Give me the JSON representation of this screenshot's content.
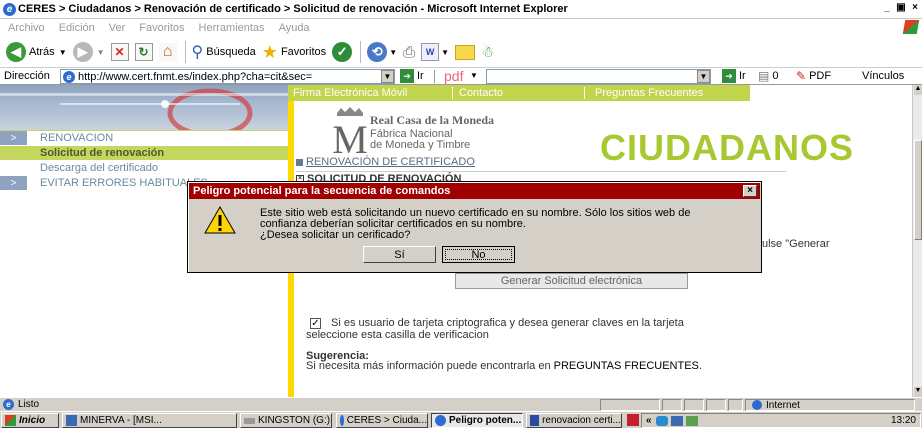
{
  "window": {
    "title": "CERES > Ciudadanos > Renovación de certificado > Solicitud de renovación - Microsoft Internet Explorer",
    "controls": [
      "_",
      "и",
      "×"
    ]
  },
  "menu": [
    "Archivo",
    "Edición",
    "Ver",
    "Favoritos",
    "Herramientas",
    "Ayuda"
  ],
  "toolbar": {
    "back": "Atrás",
    "search": "Búsqueda",
    "favorites": "Favoritos"
  },
  "address": {
    "label": "Dirección",
    "url": "http://www.cert.fnmt.es/index.php?cha=cit&sec=",
    "go": "Ir",
    "pdf_label": "pdf",
    "go2": "Ir",
    "counter": "0",
    "pdf": "PDF",
    "links": "Vínculos"
  },
  "site": {
    "topnav": [
      "Firma Electrónica Móvil",
      "Contacto",
      "Preguntas Frecuentes"
    ],
    "logo": {
      "line1": "Real Casa de la Moneda",
      "line2": "Fábrica Nacional",
      "line3": "de Moneda y Timbre"
    },
    "section_title": "CIUDADANOS",
    "breadcrumb1": "RENOVACIÓN DE CERTIFICADO",
    "breadcrumb2": "SOLICITUD DE RENOVACIÓN",
    "sidebar": [
      {
        "label": "RENOVACION",
        "arrow": ">",
        "style": "normal"
      },
      {
        "label": "Solicitud de renovación",
        "arrow": "",
        "style": "active"
      },
      {
        "label": "Descarga del certificado",
        "arrow": "",
        "style": "sub"
      },
      {
        "label": "EVITAR ERRORES HABITUALES",
        "arrow": ">",
        "style": "normal"
      }
    ],
    "generar_text": "ulse \"Generar",
    "generar_button": "Generar Solicitud electrónica",
    "checkbox_text_1": "Si es usuario de tarjeta criptografica y desea generar claves en la tarjeta",
    "checkbox_text_2": "seleccione esta casilla de verificacion",
    "suggestion_title": "Sugerencia:",
    "suggestion_text_prefix": "Si necesita más información puede encontrarla en ",
    "suggestion_link": "PREGUNTAS FRECUENTES",
    "suggestion_text_suffix": "."
  },
  "dialog": {
    "title": "Peligro potencial para la secuencia de comandos",
    "message_1": "Este sitio web está solicitando un nuevo certificado en su nombre. Sólo los sitios web de",
    "message_2": "confianza deberían solicitar certificados en su nombre.",
    "message_3": "¿Desea solicitar un cerificado?",
    "yes": "Sí",
    "no": "No",
    "close": "×"
  },
  "status": {
    "text": "Listo",
    "zone": "Internet"
  },
  "taskbar": {
    "start": "Inicio",
    "tasks": [
      "MINERVA - [MSI...",
      "KINGSTON (G:)",
      "CERES > Ciuda...",
      "Peligro poten...",
      "renovacion certi..."
    ],
    "clock": "13:20",
    "tray_prefix": "«"
  },
  "colors": {
    "dialog_title": "#a10000",
    "site_green": "#c2d34c",
    "site_yellow": "#ffd800",
    "ciudadanos": "#a8c832"
  }
}
